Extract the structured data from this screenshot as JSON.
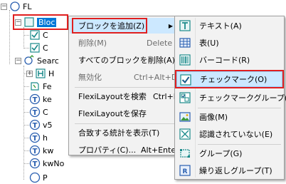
{
  "tree": {
    "root_label": "FL",
    "selected_label": "Bloc",
    "search_label": "Searc",
    "child_a_label": "C",
    "child_b_label": "C",
    "items": [
      {
        "label": "H"
      },
      {
        "label": "Fe"
      },
      {
        "label": "ke"
      },
      {
        "label": "C"
      },
      {
        "label": "v5"
      },
      {
        "label": "h"
      },
      {
        "label": "kw"
      },
      {
        "label": "kwNo"
      }
    ],
    "cut_label": "P"
  },
  "context_menu": {
    "items": [
      {
        "label": "ブロックを追加(Z)",
        "shortcut": "",
        "submenu": "▶"
      },
      {
        "label": "削除(M)",
        "shortcut": "Delete"
      },
      {
        "label": "すべてのブロックを削除(A)",
        "shortcut": ""
      },
      {
        "label": "無効化",
        "shortcut": "Ctrl+Alt+D"
      },
      {
        "label": "FlexiLayoutを検索",
        "shortcut": "Ctrl+B"
      },
      {
        "label": "FlexiLayoutを保存",
        "shortcut": ""
      },
      {
        "label": "合致する統計を表示(T)",
        "shortcut": ""
      },
      {
        "label": "プロパティ(C)...",
        "shortcut": "Alt+Enter"
      }
    ]
  },
  "submenu": {
    "items": [
      {
        "label": "テキスト(A)",
        "icon": "text-block-icon"
      },
      {
        "label": "表(U)",
        "icon": "table-block-icon"
      },
      {
        "label": "バーコード(R)",
        "icon": "barcode-block-icon"
      },
      {
        "label": "チェックマーク(O)",
        "icon": "checkmark-block-icon"
      },
      {
        "label": "チェックマークグループ(C)",
        "icon": "checkmark-group-block-icon"
      },
      {
        "label": "画像(M)",
        "icon": "picture-block-icon"
      },
      {
        "label": "認識されていない(E)",
        "icon": "unrecognized-block-icon"
      },
      {
        "label": "グループ(G)",
        "icon": "group-block-icon"
      },
      {
        "label": "繰り返しグループ(T)",
        "icon": "repeating-group-block-icon"
      }
    ]
  },
  "colors": {
    "selection": "#0078d7",
    "menu_hover": "#cce8ff",
    "highlight_box": "#e02020",
    "icon_teal": "#1a8a8a",
    "icon_blue": "#2a5fb0"
  }
}
